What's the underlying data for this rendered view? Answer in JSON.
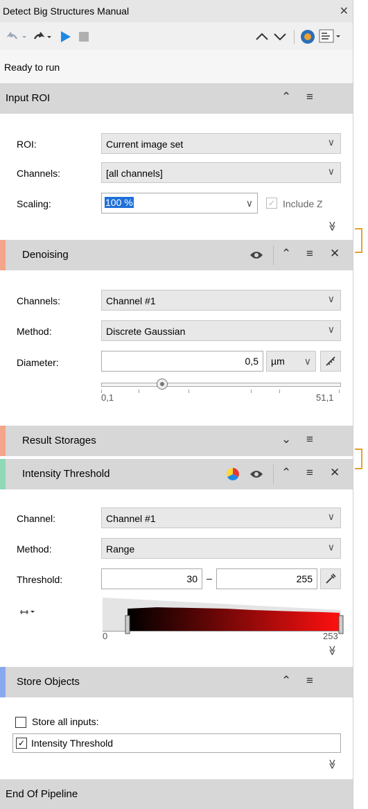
{
  "window": {
    "title": "Detect Big Structures Manual",
    "close_glyph": "✕"
  },
  "toolbar": {
    "undo_icon": "undo-icon",
    "redo_icon": "redo-icon",
    "run_icon": "play-icon",
    "stop_icon": "stop-icon",
    "up_glyph": "∧",
    "down_glyph": "∨"
  },
  "status": {
    "text": "Ready to run"
  },
  "input_roi": {
    "title": "Input ROI",
    "roi_label": "ROI:",
    "roi_value": "Current image set",
    "channels_label": "Channels:",
    "channels_value": "[all channels]",
    "scaling_label": "Scaling:",
    "scaling_value": "100 %",
    "include_z_label": "Include Z"
  },
  "denoising": {
    "title": "Denoising",
    "accent": "#f4a58a",
    "channels_label": "Channels:",
    "channels_value": "Channel #1",
    "method_label": "Method:",
    "method_value": "Discrete Gaussian",
    "diameter_label": "Diameter:",
    "diameter_value": "0,5",
    "unit": "µm",
    "slider_min": "0,1",
    "slider_max": "51,1"
  },
  "result_storages": {
    "title": "Result Storages",
    "accent": "#f4a58a"
  },
  "intensity_threshold": {
    "title": "Intensity Threshold",
    "accent": "#8fd9b6",
    "channel_label": "Channel:",
    "channel_value": "Channel #1",
    "method_label": "Method:",
    "method_value": "Range",
    "threshold_label": "Threshold:",
    "threshold_low": "30",
    "threshold_dash": "–",
    "threshold_high": "255",
    "hist_min": "0",
    "hist_max": "253"
  },
  "store_objects": {
    "title": "Store Objects",
    "accent": "#8aa8f0",
    "store_all_label": "Store all inputs:",
    "item_label": "Intensity Threshold"
  },
  "end": {
    "title": "End Of Pipeline"
  },
  "glyphs": {
    "chev_up": "⌃",
    "chev_down": "⌄",
    "menu": "≡",
    "close": "✕",
    "combo_dd": "∨",
    "expand": "≫"
  }
}
